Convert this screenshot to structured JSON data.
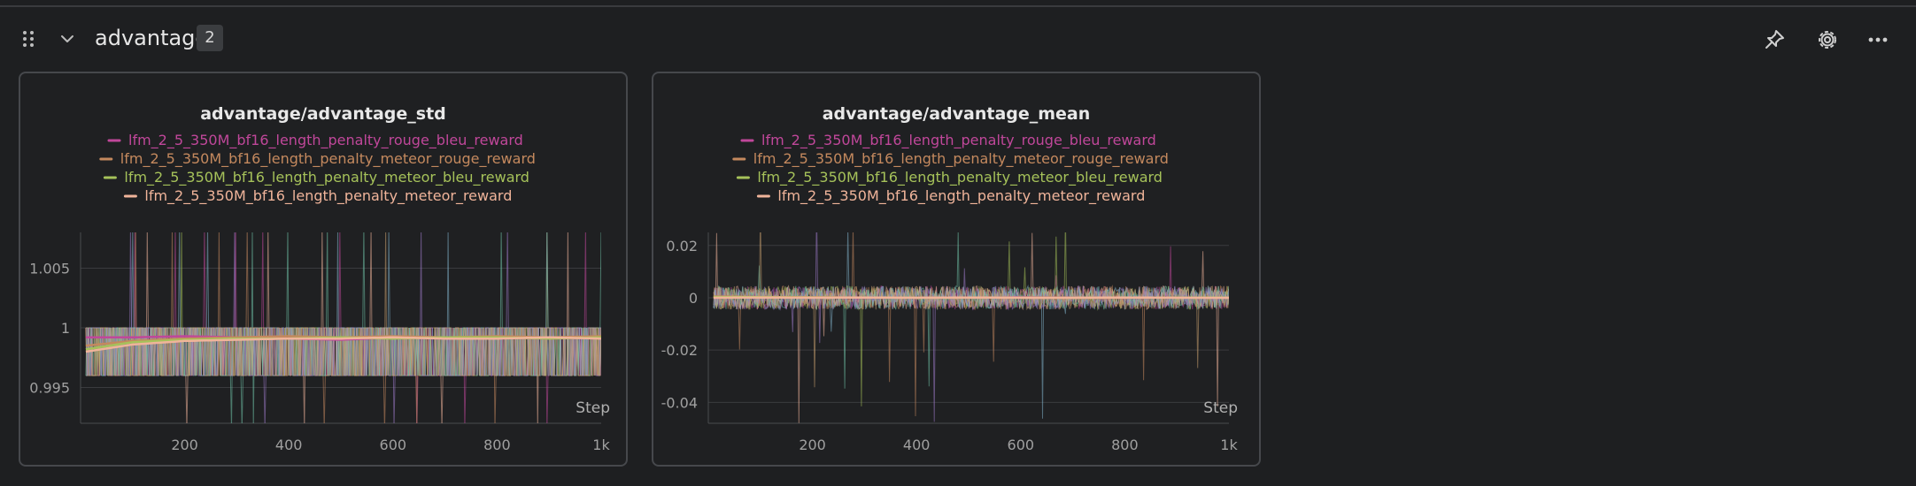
{
  "section": {
    "title": "advantage",
    "count": "2"
  },
  "icons": {
    "drag": "drag-handle-icon",
    "collapse": "chevron-down-icon",
    "pin": "pin-icon",
    "settings": "gear-icon",
    "more": "more-horizontal-icon"
  },
  "colors": {
    "background": "#1e1f21",
    "panel_border": "#46484c",
    "series": [
      "#c0479a",
      "#c4895e",
      "#a6c25a",
      "#f0b49a"
    ]
  },
  "chart_data": [
    {
      "type": "line",
      "title": "advantage/advantage_std",
      "xlabel": "Step",
      "ylabel": "",
      "xlim": [
        0,
        1000
      ],
      "ylim": [
        0.992,
        1.008
      ],
      "x_ticks": [
        200,
        400,
        600,
        800,
        1000
      ],
      "x_tick_labels": [
        "200",
        "400",
        "600",
        "800",
        "1k"
      ],
      "y_ticks": [
        0.995,
        1,
        1.005
      ],
      "y_tick_labels": [
        "0.995",
        "1",
        "1.005"
      ],
      "grid": true,
      "legend_position": "top-center",
      "series": [
        {
          "name": "lfm_2_5_350M_bf16_length_penalty_rouge_bleu_reward",
          "color": "#c0479a",
          "x": [
            10,
            100,
            200,
            300,
            400,
            500,
            600,
            700,
            800,
            900,
            1000
          ],
          "y": [
            0.9992,
            0.9992,
            0.9993,
            0.9992,
            0.9991,
            0.999,
            0.9992,
            0.9991,
            0.9992,
            0.9991,
            0.9992
          ]
        },
        {
          "name": "lfm_2_5_350M_bf16_length_penalty_meteor_rouge_reward",
          "color": "#c4895e",
          "x": [
            10,
            100,
            200,
            300,
            400,
            500,
            600,
            700,
            800,
            900,
            1000
          ],
          "y": [
            0.9985,
            0.9989,
            0.9991,
            0.9992,
            0.9993,
            0.9992,
            0.9993,
            0.9992,
            0.9993,
            0.9992,
            0.9993
          ]
        },
        {
          "name": "lfm_2_5_350M_bf16_length_penalty_meteor_bleu_reward",
          "color": "#a6c25a",
          "x": [
            10,
            100,
            200,
            300,
            400,
            500,
            600,
            700,
            800,
            900,
            1000
          ],
          "y": [
            0.9982,
            0.9988,
            0.999,
            0.9991,
            0.9991,
            0.9992,
            0.9991,
            0.9992,
            0.9992,
            0.9991,
            0.9992
          ]
        },
        {
          "name": "lfm_2_5_350M_bf16_length_penalty_meteor_reward",
          "color": "#f0b49a",
          "x": [
            10,
            100,
            200,
            300,
            400,
            500,
            600,
            700,
            800,
            900,
            1000
          ],
          "y": [
            0.998,
            0.9986,
            0.9989,
            0.999,
            0.9991,
            0.9991,
            0.9992,
            0.9991,
            0.9991,
            0.9992,
            0.9991
          ]
        }
      ]
    },
    {
      "type": "line",
      "title": "advantage/advantage_mean",
      "xlabel": "Step",
      "ylabel": "",
      "xlim": [
        0,
        1000
      ],
      "ylim": [
        -0.048,
        0.025
      ],
      "x_ticks": [
        200,
        400,
        600,
        800,
        1000
      ],
      "x_tick_labels": [
        "200",
        "400",
        "600",
        "800",
        "1k"
      ],
      "y_ticks": [
        0.02,
        0,
        -0.02,
        -0.04
      ],
      "y_tick_labels": [
        "0.02",
        "0",
        "-0.02",
        "-0.04"
      ],
      "grid": true,
      "legend_position": "top-center",
      "series": [
        {
          "name": "lfm_2_5_350M_bf16_length_penalty_rouge_bleu_reward",
          "color": "#c0479a",
          "x": [
            10,
            100,
            200,
            300,
            400,
            500,
            600,
            700,
            800,
            900,
            1000
          ],
          "y": [
            0.0,
            0.0002,
            0.0001,
            0.0,
            0.0001,
            0.0,
            0.0002,
            0.0001,
            0.0,
            0.0001,
            0.0
          ]
        },
        {
          "name": "lfm_2_5_350M_bf16_length_penalty_meteor_rouge_reward",
          "color": "#c4895e",
          "x": [
            10,
            100,
            200,
            300,
            400,
            500,
            600,
            700,
            800,
            900,
            1000
          ],
          "y": [
            0.0005,
            0.0003,
            0.0002,
            0.0001,
            0.0,
            0.0001,
            0.0,
            -0.0001,
            0.0,
            0.0001,
            0.0
          ]
        },
        {
          "name": "lfm_2_5_350M_bf16_length_penalty_meteor_bleu_reward",
          "color": "#a6c25a",
          "x": [
            10,
            100,
            200,
            300,
            400,
            500,
            600,
            700,
            800,
            900,
            1000
          ],
          "y": [
            0.0003,
            0.0002,
            0.0001,
            0.0001,
            0.0,
            0.0,
            0.0001,
            0.0,
            0.0001,
            0.0,
            0.0001
          ]
        },
        {
          "name": "lfm_2_5_350M_bf16_length_penalty_meteor_reward",
          "color": "#f0b49a",
          "x": [
            10,
            100,
            200,
            300,
            400,
            500,
            600,
            700,
            800,
            900,
            1000
          ],
          "y": [
            0.0,
            0.0001,
            0.0,
            0.0001,
            0.0,
            0.0001,
            0.0,
            0.0,
            0.0001,
            0.0,
            0.0
          ]
        }
      ]
    }
  ]
}
